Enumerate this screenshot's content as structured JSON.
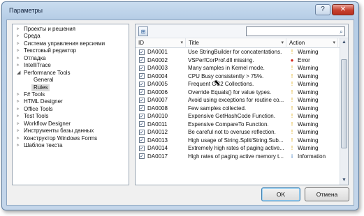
{
  "window": {
    "title": "Параметры"
  },
  "titlebar": {
    "help_label": "?",
    "close_label": "✕"
  },
  "tree": {
    "items": [
      {
        "label": "Проекты и решения",
        "expander": "▹",
        "level": 0
      },
      {
        "label": "Среда",
        "expander": "▹",
        "level": 0
      },
      {
        "label": "Система управления версиями",
        "expander": "▹",
        "level": 0
      },
      {
        "label": "Текстовый редактор",
        "expander": "▹",
        "level": 0
      },
      {
        "label": "Отладка",
        "expander": "▹",
        "level": 0
      },
      {
        "label": "IntelliTrace",
        "expander": "▹",
        "level": 0
      },
      {
        "label": "Performance Tools",
        "expander": "◢",
        "level": 0
      },
      {
        "label": "General",
        "expander": "",
        "level": 1
      },
      {
        "label": "Rules",
        "expander": "",
        "level": 1,
        "selected": true
      },
      {
        "label": "F# Tools",
        "expander": "▹",
        "level": 0
      },
      {
        "label": "HTML Designer",
        "expander": "▹",
        "level": 0
      },
      {
        "label": "Office Tools",
        "expander": "▹",
        "level": 0
      },
      {
        "label": "Test Tools",
        "expander": "▹",
        "level": 0
      },
      {
        "label": "Workflow Designer",
        "expander": "▹",
        "level": 0
      },
      {
        "label": "Инструменты базы данных",
        "expander": "▹",
        "level": 0
      },
      {
        "label": "Конструктор Windows Forms",
        "expander": "▹",
        "level": 0
      },
      {
        "label": "Шаблон текста",
        "expander": "▹",
        "level": 0
      }
    ]
  },
  "rules": {
    "search": {
      "value": "",
      "icon": "search-icon"
    },
    "columns": {
      "id": "ID",
      "title": "Title",
      "action": "Action",
      "sort_arrow": "▾"
    },
    "rows": [
      {
        "checked": "✓",
        "id": "DA0001",
        "title": "Use StringBuilder for concatentations.",
        "icon": "!",
        "kind": "warn",
        "action": "Warning"
      },
      {
        "checked": "✓",
        "id": "DA0002",
        "title": "VSPerfCorProf.dll missing.",
        "icon": "●",
        "kind": "err",
        "action": "Error"
      },
      {
        "checked": "✓",
        "id": "DA0003",
        "title": "Many samples in Kernel mode.",
        "icon": "!",
        "kind": "warn",
        "action": "Warning"
      },
      {
        "checked": "✓",
        "id": "DA0004",
        "title": "CPU Busy consistently > 75%.",
        "icon": "!",
        "kind": "warn",
        "action": "Warning"
      },
      {
        "checked": "✓",
        "id": "DA0005",
        "title": "Frequent GC2 Collections.",
        "icon": "!",
        "kind": "warn",
        "action": "Warning"
      },
      {
        "checked": "✓",
        "id": "DA0006",
        "title": "Override Equals() for value types.",
        "icon": "!",
        "kind": "warn",
        "action": "Warning"
      },
      {
        "checked": "✓",
        "id": "DA0007",
        "title": "Avoid using exceptions for routine co...",
        "icon": "!",
        "kind": "warn",
        "action": "Warning"
      },
      {
        "checked": "✓",
        "id": "DA0008",
        "title": "Few samples collected.",
        "icon": "!",
        "kind": "warn",
        "action": "Warning"
      },
      {
        "checked": "✓",
        "id": "DA0010",
        "title": "Expensive GetHashCode Function.",
        "icon": "!",
        "kind": "warn",
        "action": "Warning"
      },
      {
        "checked": "✓",
        "id": "DA0011",
        "title": "Expensive CompareTo Function.",
        "icon": "!",
        "kind": "warn",
        "action": "Warning"
      },
      {
        "checked": "✓",
        "id": "DA0012",
        "title": "Be careful not to overuse reflection.",
        "icon": "!",
        "kind": "warn",
        "action": "Warning"
      },
      {
        "checked": "✓",
        "id": "DA0013",
        "title": "High usage of String.Split/String.Sub...",
        "icon": "!",
        "kind": "warn",
        "action": "Warning"
      },
      {
        "checked": "✓",
        "id": "DA0014",
        "title": "Extremely high rates of paging active...",
        "icon": "!",
        "kind": "warn",
        "action": "Warning"
      },
      {
        "checked": "✓",
        "id": "DA0017",
        "title": "High rates of paging active memory t...",
        "icon": "i",
        "kind": "info",
        "action": "Information"
      }
    ],
    "scrollbar": {
      "up": "▲",
      "down": "▼"
    }
  },
  "buttons": {
    "ok": "OK",
    "cancel": "Отмена"
  }
}
